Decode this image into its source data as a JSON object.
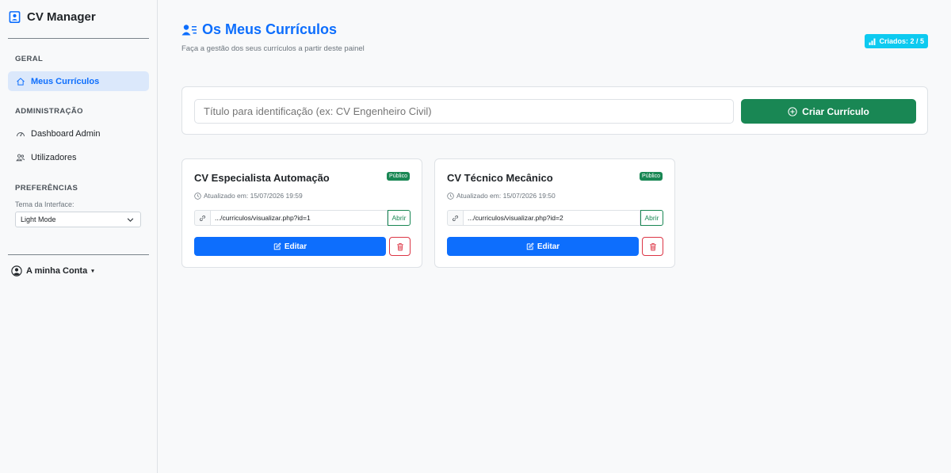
{
  "sidebar": {
    "brand": "CV Manager",
    "sections": {
      "geral": "GERAL",
      "admin": "ADMINISTRAÇÃO",
      "prefs": "PREFERÊNCIAS"
    },
    "items": {
      "meus_curriculos": "Meus Currículos",
      "dashboard_admin": "Dashboard Admin",
      "utilizadores": "Utilizadores"
    },
    "theme_label": "Tema da Interface:",
    "theme_value": "Light Mode",
    "account": "A minha Conta"
  },
  "header": {
    "title": "Os Meus Currículos",
    "subtitle": "Faça a gestão dos seus currículos a partir deste painel",
    "counter": "Criados: 2 / 5"
  },
  "create": {
    "placeholder": "Título para identificação (ex: CV Engenheiro Civil)",
    "button": "Criar Currículo"
  },
  "cvs": [
    {
      "title": "CV Especialista Automação",
      "badge": "Público",
      "updated": "Atualizado em: 15/07/2026 19:59",
      "link": ".../curriculos/visualizar.php?id=1",
      "open": "Abrir",
      "edit": "Editar"
    },
    {
      "title": "CV Técnico Mecânico",
      "badge": "Público",
      "updated": "Atualizado em: 15/07/2026 19:50",
      "link": ".../curriculos/visualizar.php?id=2",
      "open": "Abrir",
      "edit": "Editar"
    }
  ],
  "colors": {
    "primary": "#0d6efd",
    "success": "#198754",
    "info": "#0dcaf0",
    "danger": "#dc3545"
  }
}
